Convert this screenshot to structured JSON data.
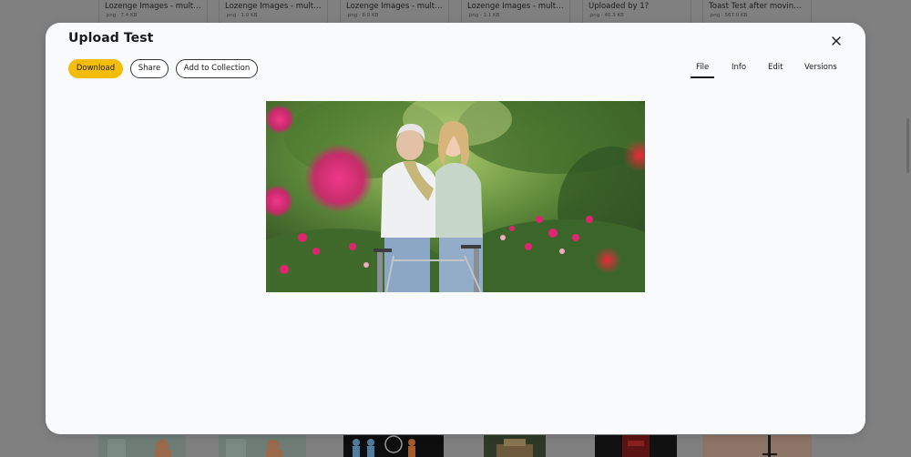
{
  "background_gallery": {
    "cards": [
      {
        "title": "Lozenge Images - multi...",
        "meta": ".png · 7.4 KB"
      },
      {
        "title": "Lozenge Images - multi...",
        "meta": ".png · 1.0 KB"
      },
      {
        "title": "Lozenge Images - multi...",
        "meta": ".png · 8.0 KB"
      },
      {
        "title": "Lozenge Images - multi...",
        "meta": ".png · 1.1 KB"
      },
      {
        "title": "Uploaded by 1?",
        "meta": ".png · 40.3 KB"
      },
      {
        "title": "Toast Test after moving ...",
        "meta": ".png · 567.0 KB"
      }
    ]
  },
  "modal": {
    "title": "Upload Test",
    "actions": {
      "download_label": "Download",
      "share_label": "Share",
      "add_to_collection_label": "Add to Collection"
    },
    "tabs": [
      {
        "label": "File",
        "active": true
      },
      {
        "label": "Info",
        "active": false
      },
      {
        "label": "Edit",
        "active": false
      },
      {
        "label": "Versions",
        "active": false
      }
    ],
    "close_icon": "close-icon",
    "preview_icon": "photo-preview"
  },
  "colors": {
    "accent": "#f5bd0b",
    "overlay": "#808080",
    "modal_bg": "#f9fafc",
    "text": "#1a1a1a"
  }
}
